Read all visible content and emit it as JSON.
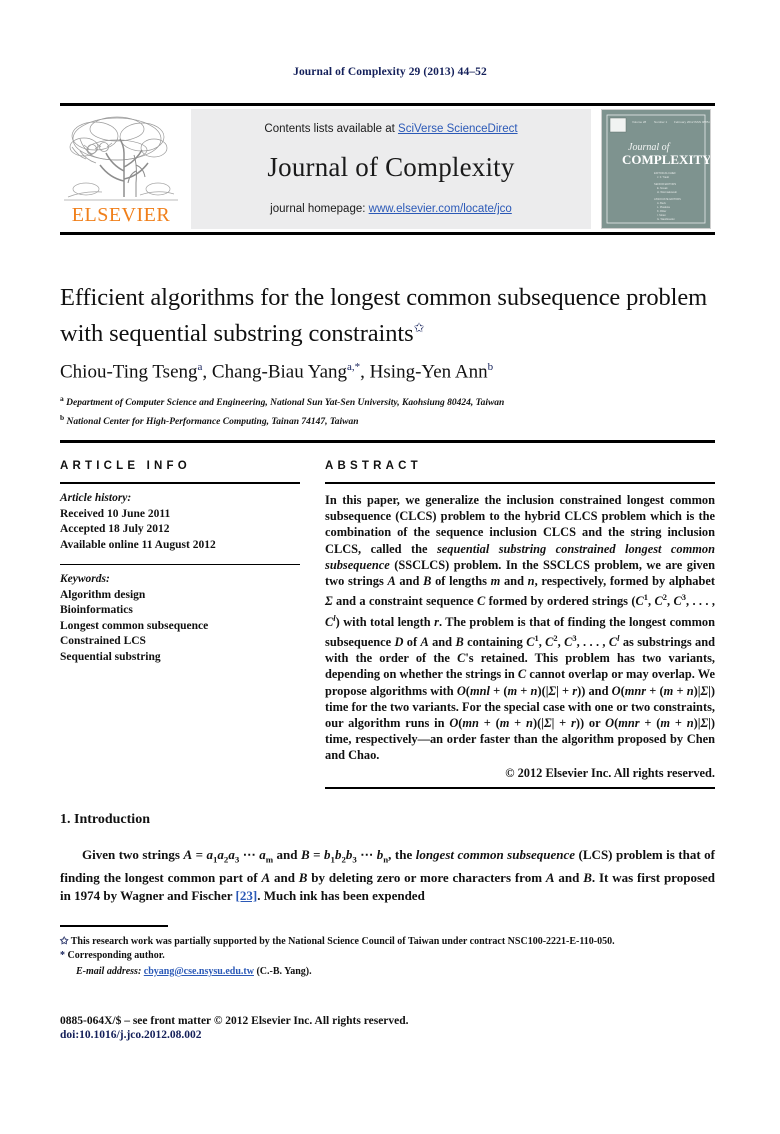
{
  "running_head": "Journal of Complexity 29 (2013) 44–52",
  "masthead": {
    "contents_prefix": "Contents lists available at ",
    "sciencedirect_link": "SciVerse ScienceDirect",
    "journal_name": "Journal of Complexity",
    "homepage_prefix": "journal homepage: ",
    "homepage_url": "www.elsevier.com/locate/jco",
    "publisher_wordmark": "ELSEVIER",
    "publisher_color": "#f07f1a",
    "link_color": "#2b59b7",
    "banner_bg": "#ececed",
    "cover": {
      "line1": "Journal of",
      "line2": "COMPLEXITY",
      "bg_color": "#7e938f"
    }
  },
  "title_block": {
    "title": "Efficient algorithms for the longest common subsequence problem with sequential substring constraints",
    "title_marker": "✩",
    "authors": [
      {
        "name": "Chiou-Ting Tseng",
        "sup": "a"
      },
      {
        "name": "Chang-Biau Yang",
        "sup": "a,*"
      },
      {
        "name": "Hsing-Yen Ann",
        "sup": "b"
      }
    ],
    "affiliations": [
      {
        "marker": "a",
        "text": "Department of Computer Science and Engineering, National Sun Yat-Sen University, Kaohsiung 80424, Taiwan"
      },
      {
        "marker": "b",
        "text": "National Center for High-Performance Computing, Tainan 74147, Taiwan"
      }
    ]
  },
  "article_info": {
    "heading": "ARTICLE INFO",
    "history_label": "Article history:",
    "history": [
      "Received 10 June 2011",
      "Accepted 18 July 2012",
      "Available online 11 August 2012"
    ],
    "keywords_label": "Keywords:",
    "keywords": [
      "Algorithm design",
      "Bioinformatics",
      "Longest common subsequence",
      "Constrained LCS",
      "Sequential substring"
    ]
  },
  "abstract": {
    "heading": "ABSTRACT",
    "copyright": "© 2012 Elsevier Inc. All rights reserved."
  },
  "introduction": {
    "heading": "1.  Introduction",
    "reference_number": "[23]"
  },
  "footnotes": {
    "funding_marker": "✩",
    "funding": "This research work was partially supported by the National Science Council of Taiwan under contract NSC100-2221-E-110-050.",
    "corresponding_marker": "*",
    "corresponding": "Corresponding author.",
    "email_label": "E-mail address:",
    "email_address": "cbyang@cse.nsysu.edu.tw",
    "email_owner": "(C.-B. Yang)."
  },
  "bottom": {
    "issn_line": "0885-064X/$ – see front matter © 2012 Elsevier Inc. All rights reserved.",
    "doi_line": "doi:10.1016/j.jco.2012.08.002"
  }
}
